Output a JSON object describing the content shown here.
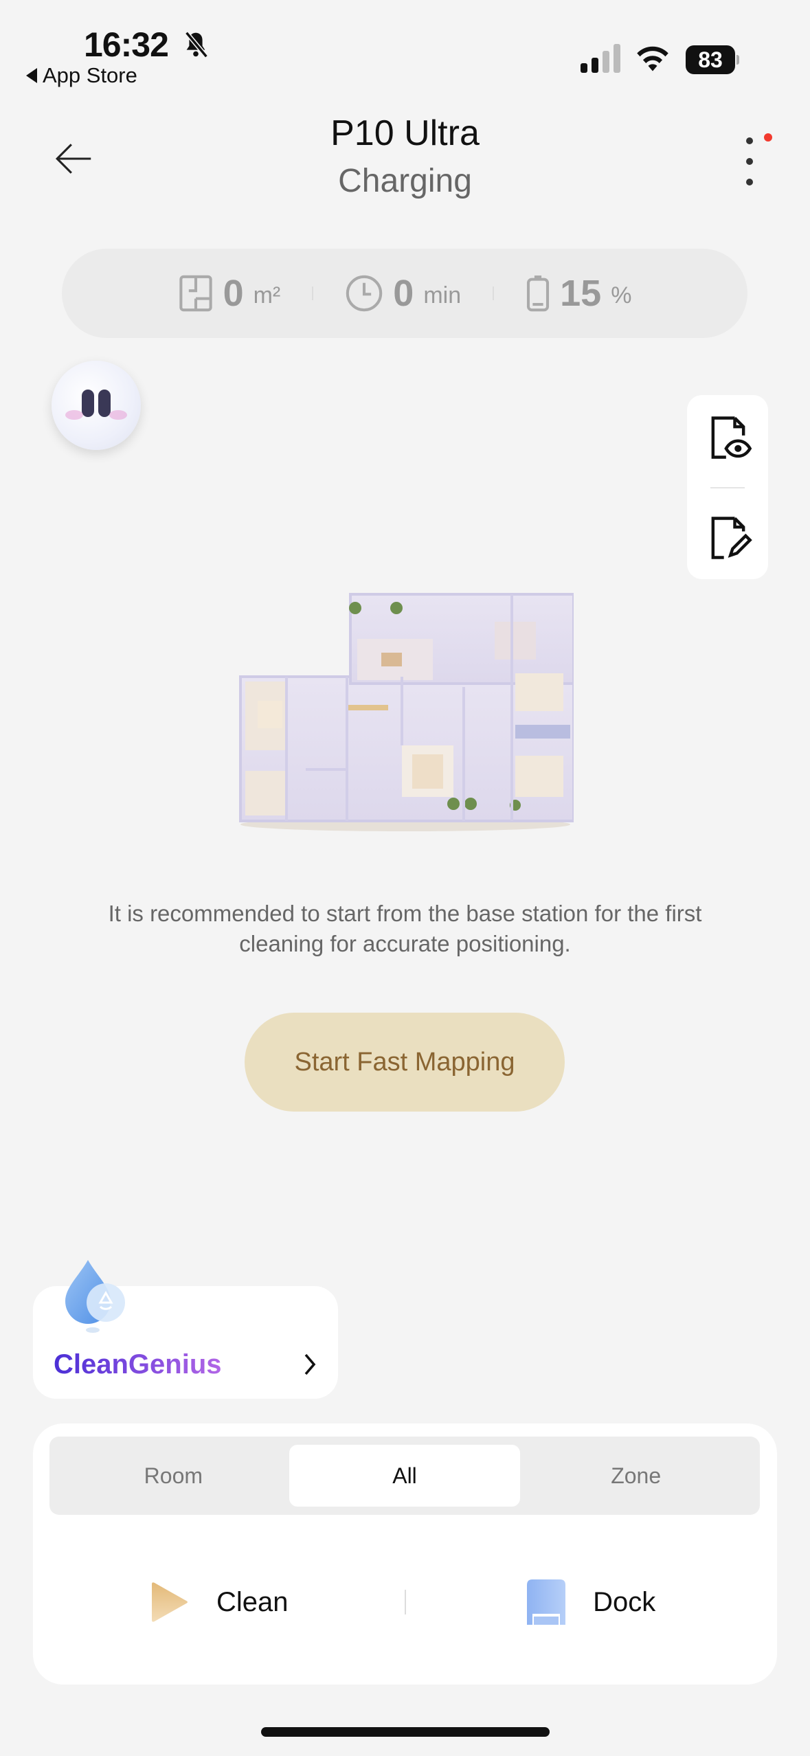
{
  "status_bar": {
    "time": "16:32",
    "back_app": "App Store",
    "battery": "83",
    "icons": [
      "bell-slash-icon",
      "signal-icon",
      "wifi-icon",
      "battery-icon"
    ]
  },
  "header": {
    "title": "P10 Ultra",
    "subtitle": "Charging",
    "back_icon": "arrow-left-icon",
    "more_icon": "more-vertical-icon",
    "notification_dot_color": "#f23a2e"
  },
  "stats": [
    {
      "icon": "floorplan-icon",
      "value": "0",
      "unit": "m²"
    },
    {
      "icon": "clock-icon",
      "value": "0",
      "unit": "min"
    },
    {
      "icon": "battery-icon",
      "value": "15",
      "unit": "%"
    }
  ],
  "map_tools": [
    {
      "icon": "map-view-icon"
    },
    {
      "icon": "map-edit-icon"
    }
  ],
  "hint": "It is recommended to start from the base station for the first cleaning for accurate positioning.",
  "fast_mapping_button": "Start Fast Mapping",
  "clean_genius": {
    "label": "CleanGenius"
  },
  "modes": {
    "items": [
      "Room",
      "All",
      "Zone"
    ],
    "selected": "All"
  },
  "actions": {
    "clean": "Clean",
    "dock": "Dock"
  },
  "colors": {
    "accent_button_bg": "#eadfc0",
    "accent_button_text": "#8a6532",
    "clean_genius_gradient": [
      "#4b2fd6",
      "#b266e6"
    ]
  }
}
